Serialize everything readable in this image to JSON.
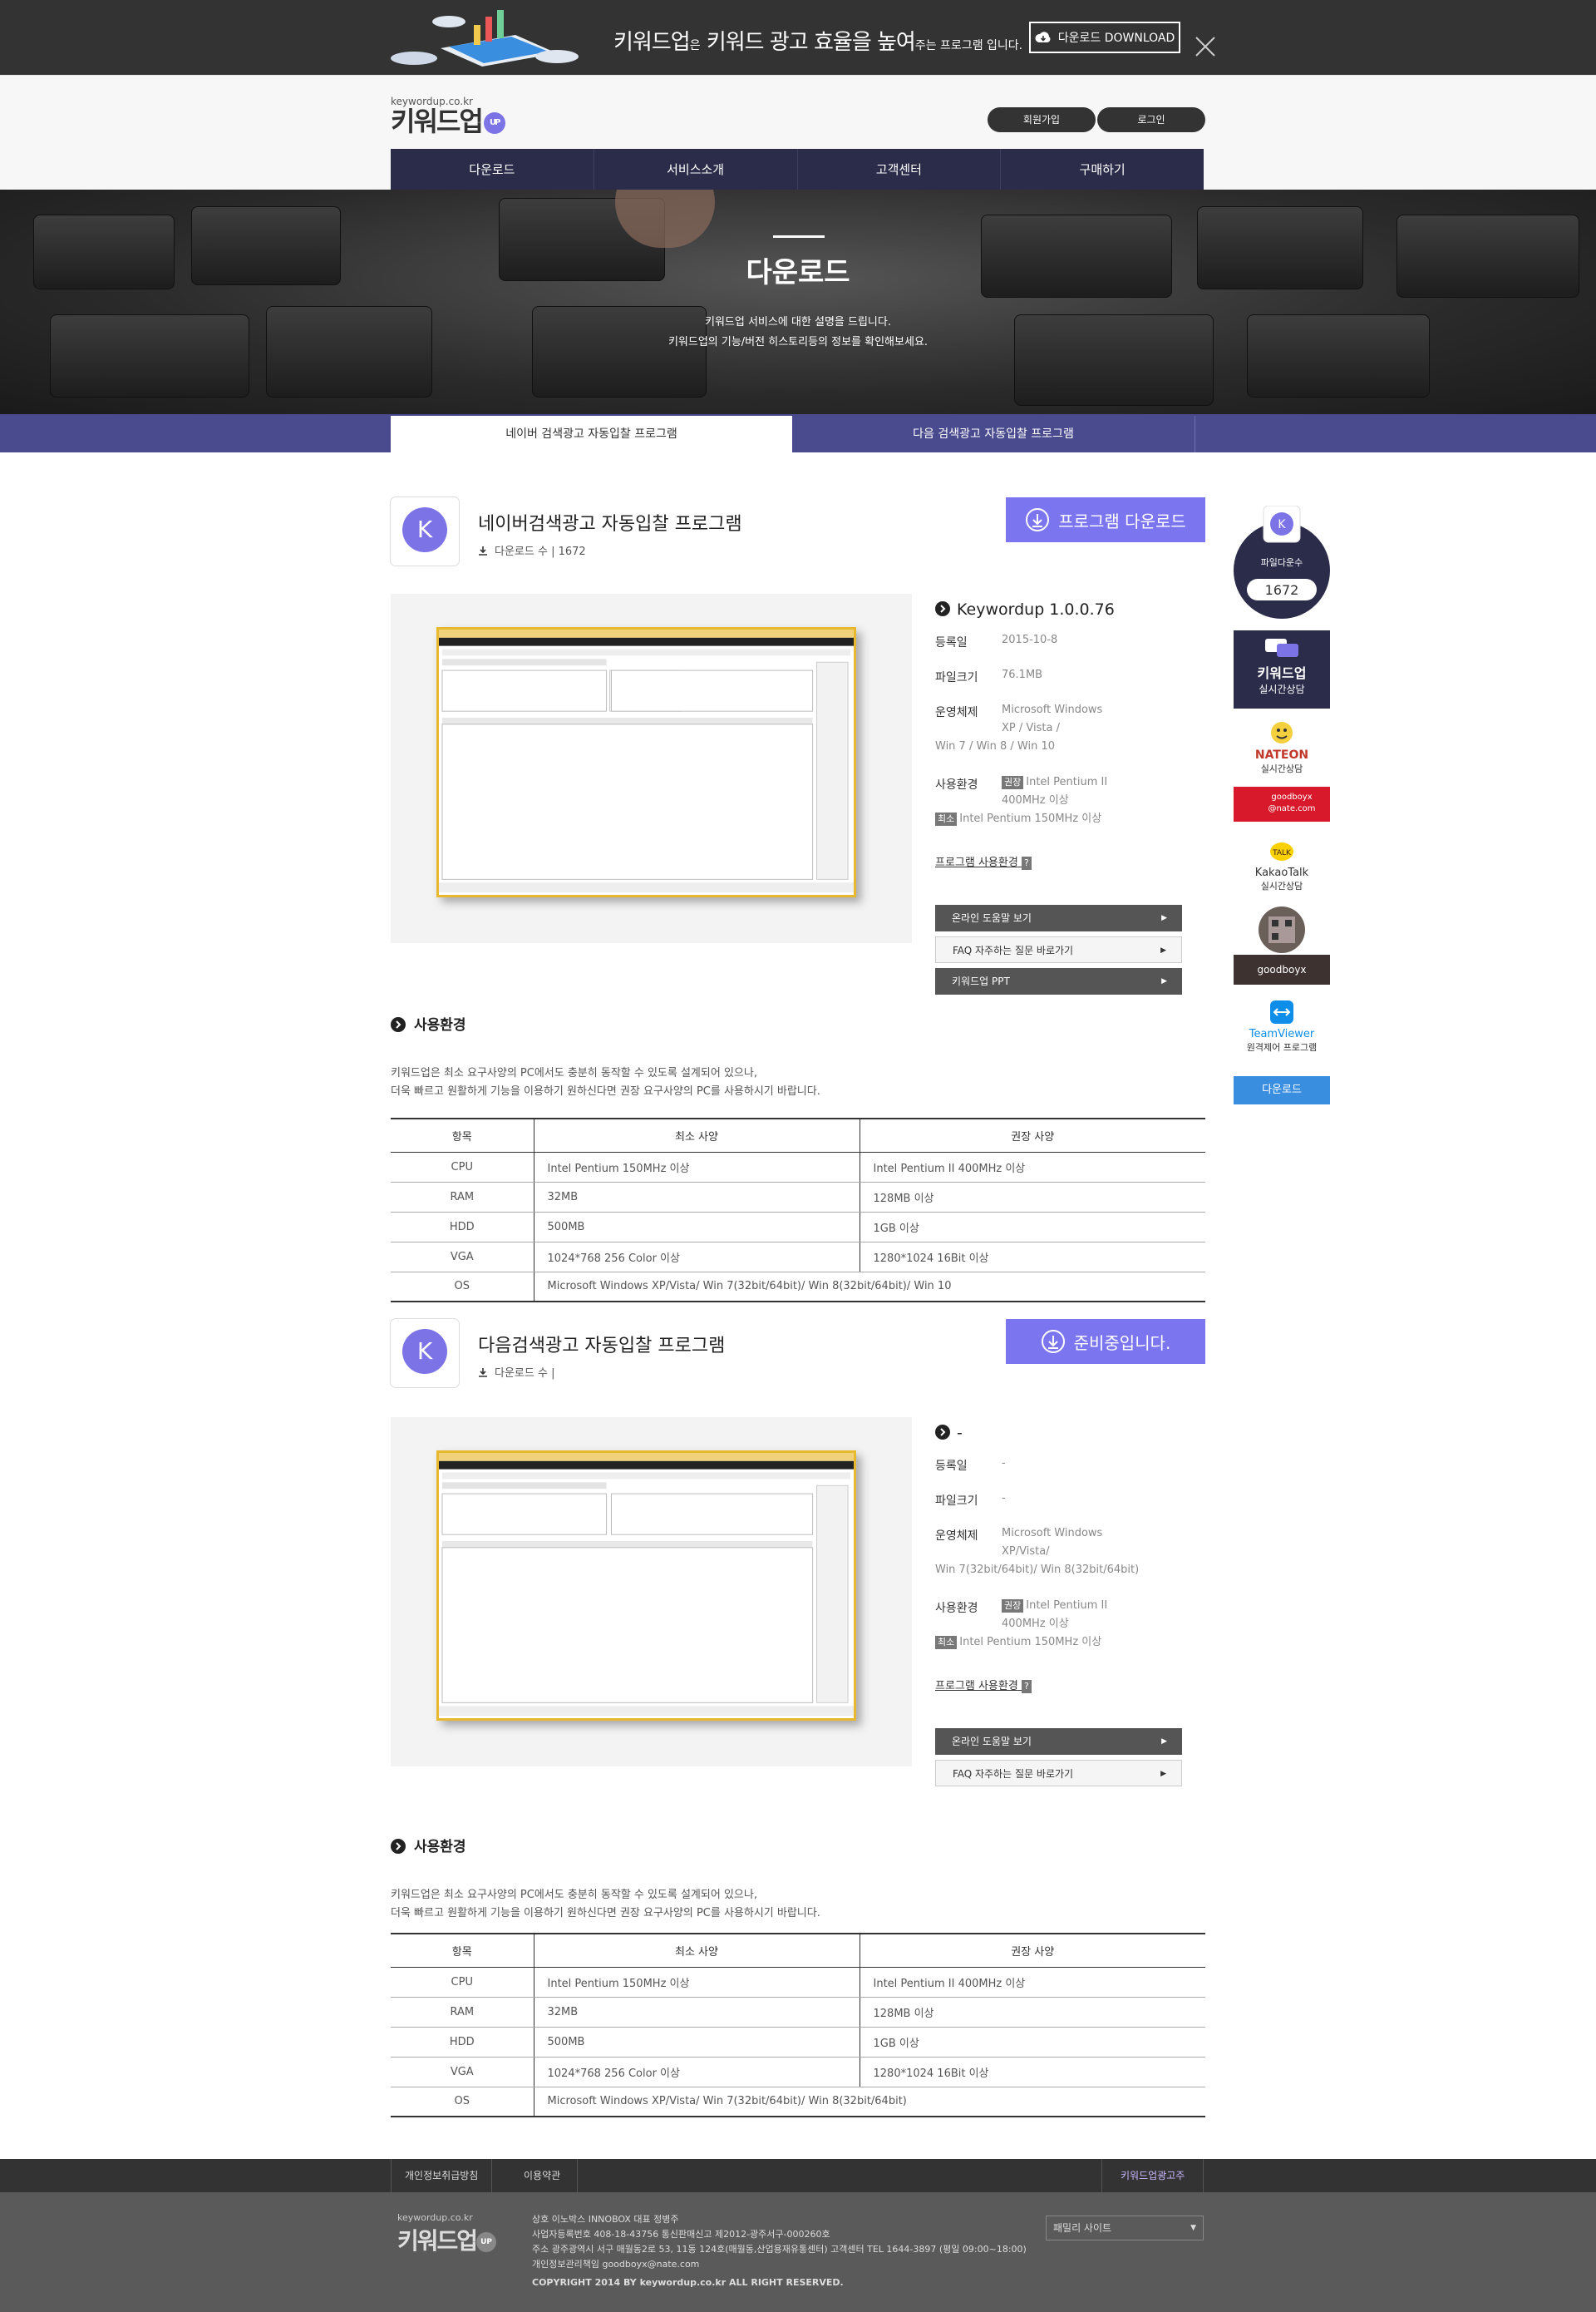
{
  "banner": {
    "text_a": "키워드업",
    "text_sub": "은",
    "text_b": "키워드 광고 효율을 높여",
    "text_sub2": "주는 프로그램 입니다.",
    "download_btn": "다운로드 DOWNLOAD"
  },
  "header": {
    "domain": "keywordup.co.kr",
    "logo": "키워드업",
    "logo_badge": "UP",
    "join": "회원가입",
    "login": "로그인"
  },
  "nav": [
    "다운로드",
    "서비스소개",
    "고객센터",
    "구매하기"
  ],
  "hero": {
    "title": "다운로드",
    "desc1": "키워드업 서비스에 대한 설명을 드립니다.",
    "desc2": "키워드업의 기능/버전 히스토리등의 정보를 확인해보세요."
  },
  "tabs": [
    "네이버 검색광고 자동입찰 프로그램",
    "다음 검색광고 자동입찰 프로그램"
  ],
  "apps": [
    {
      "icon": "K",
      "title": "네이버검색광고 자동입찰 프로그램",
      "count": "다운로드 수 | 1672",
      "button": "프로그램 다운로드",
      "version": "Keywordup 1.0.0.76",
      "reg_label": "등록일",
      "reg": "2015-10-8",
      "size_label": "파일크기",
      "size": "76.1MB",
      "os_label": "운영체제",
      "os1": "Microsoft Windows",
      "os2": "XP / Vista /",
      "os3": "Win 7 / Win 8 / Win 10",
      "env_label": "사용환경",
      "rec_tag": "권장",
      "rec1": "Intel Pentium II",
      "rec2": "400MHz 이상",
      "min_tag": "최소",
      "min": "Intel Pentium 150MHz 이상",
      "help": "프로그램 사용환경",
      "btns": [
        "온라인 도움말 보기",
        "FAQ 자주하는 질문 바로가기",
        "키워드업 PPT"
      ]
    },
    {
      "icon": "K",
      "title": "다음검색광고 자동입찰 프로그램",
      "count": "다운로드 수 |",
      "button": "준비중입니다.",
      "version": "-",
      "reg_label": "등록일",
      "reg": "-",
      "size_label": "파일크기",
      "size": "-",
      "os_label": "운영체제",
      "os1": "Microsoft Windows",
      "os2": "XP/Vista/",
      "os3": "Win 7(32bit/64bit)/ Win 8(32bit/64bit)",
      "env_label": "사용환경",
      "rec_tag": "권장",
      "rec1": "Intel Pentium II",
      "rec2": "400MHz 이상",
      "min_tag": "최소",
      "min": "Intel Pentium 150MHz 이상",
      "help": "프로그램 사용환경",
      "btns": [
        "온라인 도움말 보기",
        "FAQ 자주하는 질문 바로가기"
      ]
    }
  ],
  "req": {
    "title": "사용환경",
    "desc1": "키워드업은 최소 요구사양의 PC에서도 충분히 동작할 수 있도록 설계되어 있으나,",
    "desc2": "더욱 빠르고 원활하게 기능을 이용하기 원하신다면 권장 요구사양의 PC를 사용하시기 바랍니다.",
    "headers": [
      "항목",
      "최소 사양",
      "권장 사양"
    ],
    "rows1": [
      [
        "CPU",
        "Intel Pentium 150MHz 이상",
        "Intel Pentium II 400MHz 이상"
      ],
      [
        "RAM",
        "32MB",
        "128MB 이상"
      ],
      [
        "HDD",
        "500MB",
        "1GB 이상"
      ],
      [
        "VGA",
        "1024*768 256 Color 이상",
        "1280*1024 16Bit 이상"
      ],
      [
        "OS",
        "Microsoft Windows XP/Vista/ Win 7(32bit/64bit)/ Win 8(32bit/64bit)/ Win 10",
        ""
      ]
    ],
    "rows2": [
      [
        "CPU",
        "Intel Pentium 150MHz 이상",
        "Intel Pentium II 400MHz 이상"
      ],
      [
        "RAM",
        "32MB",
        "128MB 이상"
      ],
      [
        "HDD",
        "500MB",
        "1GB 이상"
      ],
      [
        "VGA",
        "1024*768 256 Color 이상",
        "1280*1024 16Bit 이상"
      ],
      [
        "OS",
        "Microsoft Windows XP/Vista/ Win 7(32bit/64bit)/ Win 8(32bit/64bit)",
        ""
      ]
    ]
  },
  "side": {
    "count_label": "파일다운수",
    "count": "1672",
    "kw_title": "키워드업",
    "kw_sub": "실시간상담",
    "nateon": "NATEON",
    "nateon_sub": "실시간상담",
    "nate_id": "goodboyx @nate.com",
    "kakao": "KakaoTalk",
    "kakao_sub": "실시간상담",
    "kakao_id": "goodboyx",
    "tv": "TeamViewer",
    "tv_sub": "원격제어 프로그램",
    "tv_dl": "다운로드"
  },
  "footer": {
    "privacy": "개인정보취급방침",
    "terms": "이용약관",
    "ad": "키워드업광고주",
    "family": "패밀리 사이트",
    "l1": "상호 이노박스 INNOBOX  대표 정병주",
    "l2": "사업자등록번호 408-18-43756  통신판매신고 제2012-광주서구-000260호",
    "l3": "주소 광주광역시 서구 매월동2로 53, 11동 124호(매월동,산업용재유통센터)  고객센터 TEL 1644-3897 (평일 09:00~18:00)",
    "l4": "개인정보관리책임 goodboyx@nate.com",
    "l5": "COPYRIGHT 2014 BY keywordup.co.kr ALL RIGHT RESERVED."
  }
}
